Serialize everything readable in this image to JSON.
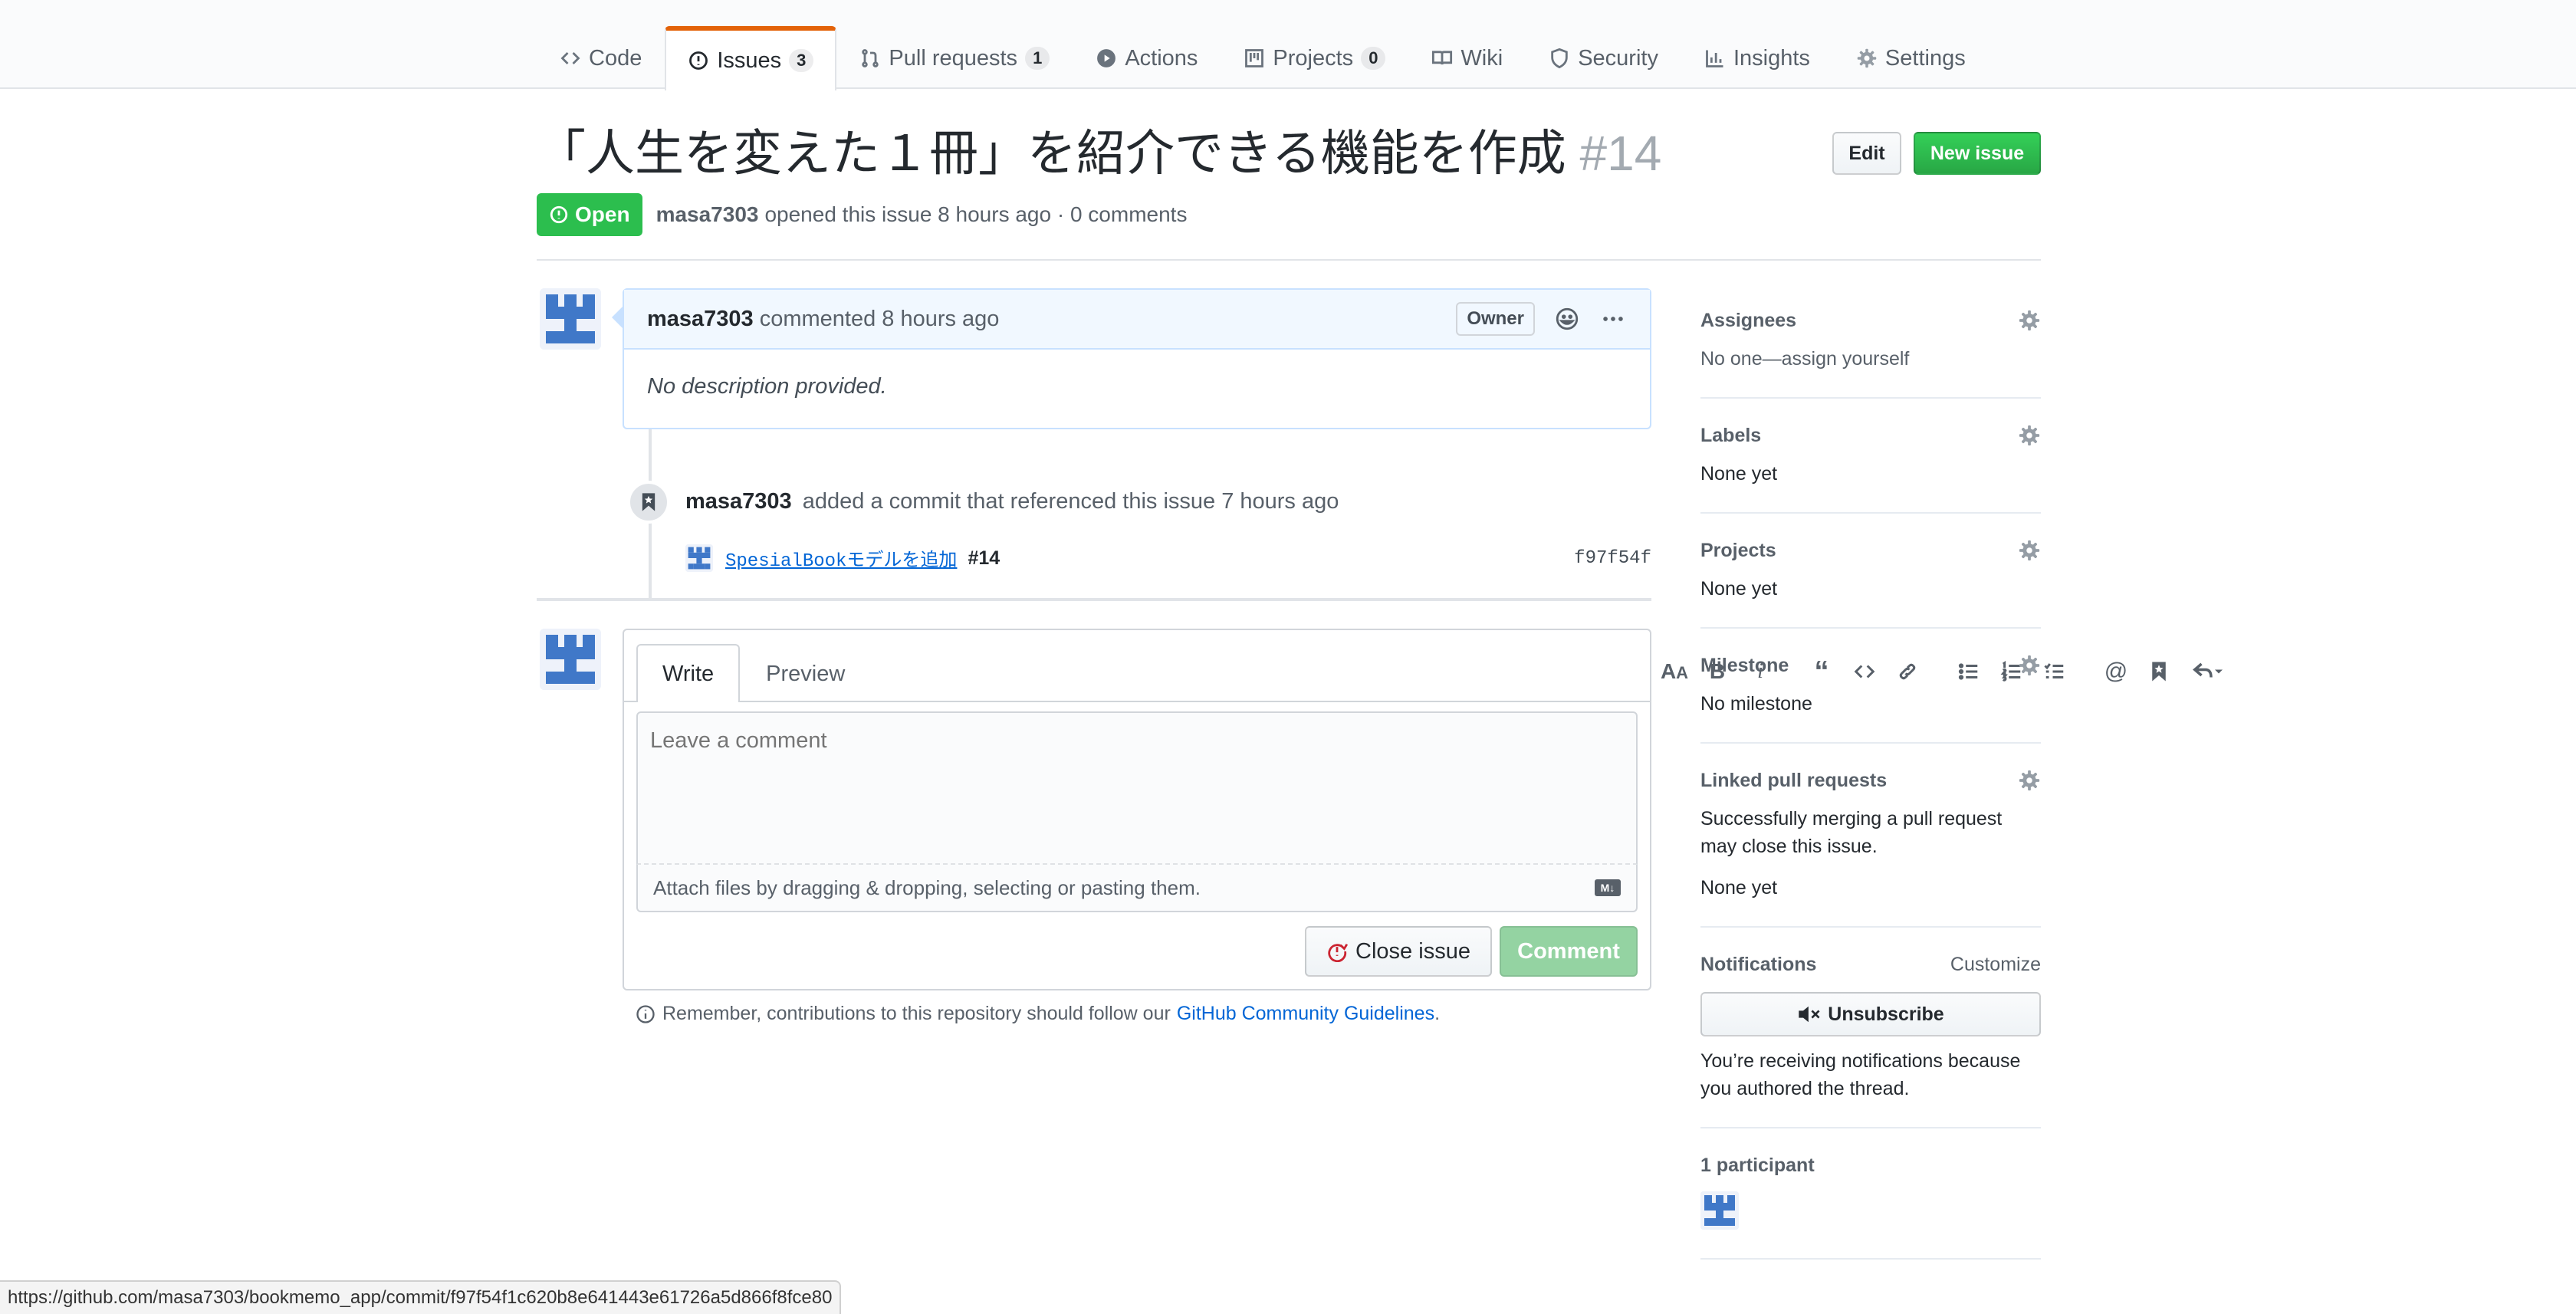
{
  "nav": {
    "tabs": [
      {
        "label": "Code",
        "count": ""
      },
      {
        "label": "Issues",
        "count": "3"
      },
      {
        "label": "Pull requests",
        "count": "1"
      },
      {
        "label": "Actions",
        "count": ""
      },
      {
        "label": "Projects",
        "count": "0"
      },
      {
        "label": "Wiki",
        "count": ""
      },
      {
        "label": "Security",
        "count": ""
      },
      {
        "label": "Insights",
        "count": ""
      },
      {
        "label": "Settings",
        "count": ""
      }
    ],
    "selected": "Issues"
  },
  "issue": {
    "title": "「人生を変えた１冊」を紹介できる機能を作成",
    "number": "#14",
    "state": "Open",
    "author": "masa7303",
    "meta": "opened this issue 8 hours ago · 0 comments",
    "edit_label": "Edit",
    "new_issue_label": "New issue"
  },
  "comment": {
    "author": "masa7303",
    "time": "commented 8 hours ago",
    "role": "Owner",
    "body": "No description provided."
  },
  "event": {
    "author": "masa7303",
    "text": "added a commit that referenced this issue 7 hours ago",
    "commit_message": "SpesialBookモデルを追加",
    "commit_ref": "#14",
    "commit_sha": "f97f54f"
  },
  "form": {
    "tab_write": "Write",
    "tab_preview": "Preview",
    "placeholder": "Leave a comment",
    "attach_text": "Attach files by dragging & dropping, selecting or pasting them.",
    "markdown_badge": "M↓",
    "close_label": "Close issue",
    "comment_label": "Comment",
    "remember_text": "Remember, contributions to this repository should follow our",
    "guidelines_link": "GitHub Community Guidelines",
    "period": "."
  },
  "sidebar": {
    "assignees": {
      "heading": "Assignees",
      "value": "No one—assign yourself"
    },
    "labels": {
      "heading": "Labels",
      "value": "None yet"
    },
    "projects": {
      "heading": "Projects",
      "value": "None yet"
    },
    "milestone": {
      "heading": "Milestone",
      "value": "No milestone"
    },
    "linked_prs": {
      "heading": "Linked pull requests",
      "description": "Successfully merging a pull request may close this issue.",
      "value": "None yet"
    },
    "notifications": {
      "heading": "Notifications",
      "customize": "Customize",
      "unsubscribe": "Unsubscribe",
      "reason": "You’re receiving notifications because you authored the thread."
    },
    "participants": {
      "heading": "1 participant"
    }
  },
  "statusbar": {
    "url": "https://github.com/masa7303/bookmemo_app/commit/f97f54f1c620b8e641443e61726a5d866f8fce80"
  },
  "colors": {
    "accent_orange": "#e36209",
    "open_green": "#2cbe4e",
    "link_blue": "#0366d6",
    "avatar_blue": "#4078c8"
  }
}
